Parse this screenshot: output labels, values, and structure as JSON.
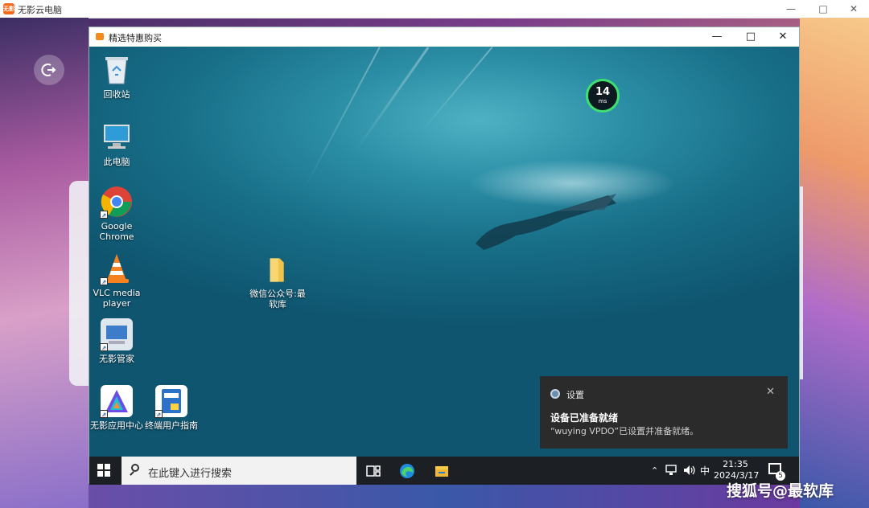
{
  "outer_window": {
    "app_icon_text": "无影",
    "title": "无影云电脑"
  },
  "inner_window": {
    "title": "精选特惠购买"
  },
  "latency": {
    "value": "14",
    "unit": "ms"
  },
  "desktop_icons": [
    {
      "label": "回收站"
    },
    {
      "label": "此电脑"
    },
    {
      "label": "Google Chrome"
    },
    {
      "label": "VLC media player"
    },
    {
      "label": "无影管家"
    },
    {
      "label": "无影应用中心"
    },
    {
      "label": "终端用户指南"
    },
    {
      "label": "微信公众号:最软库"
    }
  ],
  "notification": {
    "app": "设置",
    "heading": "设备已准备就绪",
    "body": "“wuying VPDO”已设置并准备就绪。"
  },
  "taskbar": {
    "search_placeholder": "在此键入进行搜索",
    "ime": "中",
    "time": "21:35",
    "date": "2024/3/17",
    "notification_count": "5"
  },
  "watermark": "搜狐号@最软库",
  "colors": {
    "latency_ring": "#3ee070",
    "taskbar": "#1c1f24",
    "notification_bg": "#2b2b2b"
  }
}
